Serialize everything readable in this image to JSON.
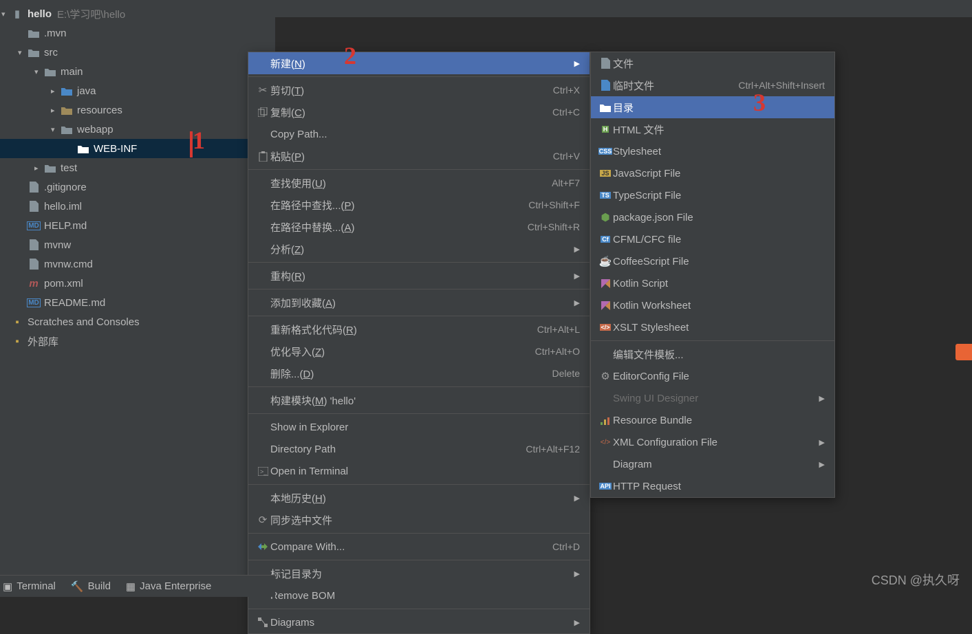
{
  "project": {
    "name": "hello",
    "path": "E:\\学习吧\\hello",
    "tree": [
      {
        "label": ".mvn",
        "indent": 1,
        "icon": "folder"
      },
      {
        "label": "src",
        "indent": 1,
        "icon": "folder",
        "arrow": "down"
      },
      {
        "label": "main",
        "indent": 2,
        "icon": "folder",
        "arrow": "down"
      },
      {
        "label": "java",
        "indent": 3,
        "icon": "folder-blue",
        "arrow": "right"
      },
      {
        "label": "resources",
        "indent": 3,
        "icon": "folder-res",
        "arrow": "right"
      },
      {
        "label": "webapp",
        "indent": 3,
        "icon": "folder",
        "arrow": "down"
      },
      {
        "label": "WEB-INF",
        "indent": 4,
        "icon": "folder",
        "selected": true
      },
      {
        "label": "test",
        "indent": 2,
        "icon": "folder",
        "arrow": "right"
      },
      {
        "label": ".gitignore",
        "indent": 1,
        "icon": "file"
      },
      {
        "label": "hello.iml",
        "indent": 1,
        "icon": "file"
      },
      {
        "label": "HELP.md",
        "indent": 1,
        "icon": "md"
      },
      {
        "label": "mvnw",
        "indent": 1,
        "icon": "file"
      },
      {
        "label": "mvnw.cmd",
        "indent": 1,
        "icon": "file"
      },
      {
        "label": "pom.xml",
        "indent": 1,
        "icon": "mvn"
      },
      {
        "label": "README.md",
        "indent": 1,
        "icon": "md"
      }
    ],
    "extras": [
      "Scratches and Consoles",
      "外部库"
    ]
  },
  "context_menu": {
    "groups": [
      [
        {
          "label": "新建(N)",
          "submenu": true,
          "selected": true
        }
      ],
      [
        {
          "label": "剪切(T)",
          "shortcut": "Ctrl+X",
          "icon": "cut"
        },
        {
          "label": "复制(C)",
          "shortcut": "Ctrl+C",
          "icon": "copy"
        },
        {
          "label": "Copy Path..."
        },
        {
          "label": "粘贴(P)",
          "shortcut": "Ctrl+V",
          "icon": "paste"
        }
      ],
      [
        {
          "label": "查找使用(U)",
          "shortcut": "Alt+F7"
        },
        {
          "label": "在路径中查找...(P)",
          "shortcut": "Ctrl+Shift+F"
        },
        {
          "label": "在路径中替换...(A)",
          "shortcut": "Ctrl+Shift+R"
        },
        {
          "label": "分析(Z)",
          "submenu": true
        }
      ],
      [
        {
          "label": "重构(R)",
          "submenu": true
        }
      ],
      [
        {
          "label": "添加到收藏(A)",
          "submenu": true
        }
      ],
      [
        {
          "label": "重新格式化代码(R)",
          "shortcut": "Ctrl+Alt+L"
        },
        {
          "label": "优化导入(Z)",
          "shortcut": "Ctrl+Alt+O"
        },
        {
          "label": "删除...(D)",
          "shortcut": "Delete"
        }
      ],
      [
        {
          "label": "构建模块(M) 'hello'"
        }
      ],
      [
        {
          "label": "Show in Explorer"
        },
        {
          "label": "Directory Path",
          "shortcut": "Ctrl+Alt+F12"
        },
        {
          "label": "Open in Terminal",
          "icon": "terminal"
        }
      ],
      [
        {
          "label": "本地历史(H)",
          "submenu": true
        },
        {
          "label": "同步选中文件",
          "icon": "sync"
        }
      ],
      [
        {
          "label": "Compare With...",
          "shortcut": "Ctrl+D",
          "icon": "diff"
        }
      ],
      [
        {
          "label": "标记目录为",
          "submenu": true
        },
        {
          "label": "Remove BOM"
        }
      ],
      [
        {
          "label": "Diagrams",
          "submenu": true,
          "icon": "diagram"
        }
      ]
    ]
  },
  "new_submenu": {
    "groups": [
      [
        {
          "label": "文件",
          "icon": "file"
        },
        {
          "label": "临时文件",
          "shortcut": "Ctrl+Alt+Shift+Insert",
          "icon": "scratch"
        },
        {
          "label": "目录",
          "icon": "folder",
          "selected": true
        },
        {
          "label": "HTML 文件",
          "icon": "html"
        },
        {
          "label": "Stylesheet",
          "icon": "css"
        },
        {
          "label": "JavaScript File",
          "icon": "js"
        },
        {
          "label": "TypeScript File",
          "icon": "ts"
        },
        {
          "label": "package.json File",
          "icon": "node"
        },
        {
          "label": "CFML/CFC file",
          "icon": "cf"
        },
        {
          "label": "CoffeeScript File",
          "icon": "coffee"
        },
        {
          "label": "Kotlin Script",
          "icon": "kt"
        },
        {
          "label": "Kotlin Worksheet",
          "icon": "kt"
        },
        {
          "label": "XSLT Stylesheet",
          "icon": "xslt"
        }
      ],
      [
        {
          "label": "编辑文件模板..."
        },
        {
          "label": "EditorConfig File",
          "icon": "gear"
        },
        {
          "label": "Swing UI Designer",
          "submenu": true,
          "disabled": true
        },
        {
          "label": "Resource Bundle",
          "icon": "bundle"
        },
        {
          "label": "XML Configuration File",
          "submenu": true,
          "icon": "xml"
        },
        {
          "label": "Diagram",
          "submenu": true
        },
        {
          "label": "HTTP Request",
          "icon": "api"
        }
      ]
    ]
  },
  "bottombar": {
    "terminal": "Terminal",
    "build": "Build",
    "java_ee": "Java Enterprise"
  },
  "watermark": "CSDN @执久呀",
  "annotations": {
    "a1": "1",
    "a2": "2",
    "a3": "3"
  }
}
